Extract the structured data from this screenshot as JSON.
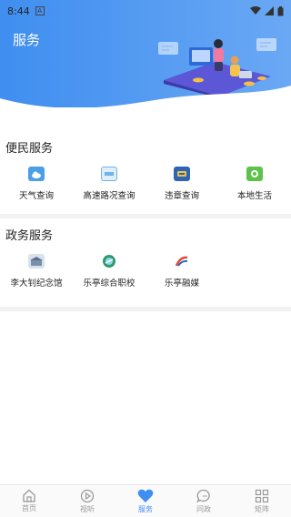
{
  "status_bar": {
    "time": "8:44",
    "notification_icon": "A"
  },
  "header": {
    "title": "服务"
  },
  "sections": [
    {
      "title": "便民服务",
      "items": [
        {
          "label": "天气查询",
          "icon": "weather-icon",
          "color": "#4a9fe6"
        },
        {
          "label": "高速路况查询",
          "icon": "highway-icon",
          "color": "#6fb3e8"
        },
        {
          "label": "违章查询",
          "icon": "violation-icon",
          "color": "#2c64b8"
        },
        {
          "label": "本地生活",
          "icon": "local-life-icon",
          "color": "#5cc24a"
        }
      ]
    },
    {
      "title": "政务服务",
      "items": [
        {
          "label": "李大钊纪念馆",
          "icon": "memorial-icon",
          "color": "#7a8fa8"
        },
        {
          "label": "乐亭综合职校",
          "icon": "school-icon",
          "color": "#2f9a6a"
        },
        {
          "label": "乐亭融媒",
          "icon": "media-icon",
          "color": "#e04a3a"
        }
      ]
    }
  ],
  "tabs": [
    {
      "label": "首页",
      "icon": "home-icon",
      "active": false
    },
    {
      "label": "视听",
      "icon": "play-icon",
      "active": false
    },
    {
      "label": "服务",
      "icon": "heart-icon",
      "active": true
    },
    {
      "label": "问政",
      "icon": "chat-icon",
      "active": false
    },
    {
      "label": "矩阵",
      "icon": "grid-icon",
      "active": false
    }
  ],
  "colors": {
    "accent": "#3f8ef0",
    "tab_inactive": "#999999"
  }
}
